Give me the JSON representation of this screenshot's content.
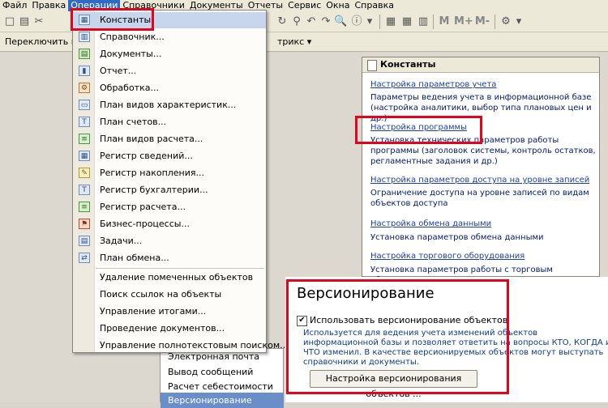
{
  "menubar": {
    "items": [
      "Файл",
      "Правка",
      "Операции",
      "Справочники",
      "Документы",
      "Отчеты",
      "Сервис",
      "Окна",
      "Справка"
    ]
  },
  "toolbar": {
    "m_label": "M",
    "mplus_label": "M+",
    "mminus_label": "M-"
  },
  "bar2": {
    "left_text": "Переключить инте",
    "right_text": "трикс"
  },
  "dropdown": {
    "items": [
      "Константы",
      "Справочник...",
      "Документы...",
      "Отчет...",
      "Обработка...",
      "План видов характеристик...",
      "План счетов...",
      "План видов расчета...",
      "Регистр сведений...",
      "Регистр накопления...",
      "Регистр бухгалтерии...",
      "Регистр расчета...",
      "Бизнес-процессы...",
      "Задачи...",
      "План обмена..."
    ],
    "items2": [
      "Удаление помеченных объектов",
      "Поиск ссылок на объекты",
      "Управление итогами...",
      "Проведение документов...",
      "Управление полнотекстовым поиском..."
    ]
  },
  "constants_panel": {
    "title": "Константы",
    "sections": [
      {
        "link": "Настройка параметров учета",
        "desc": "Параметры ведения учета в информационной базе (настройка аналитики, выбор типа плановых цен и др.)"
      },
      {
        "link": "Настройка программы",
        "desc": "Установка технических параметров работы программы (заголовок системы, контроль остатков, регламентные задания и др.)"
      },
      {
        "link": "Настройка параметров доступа на уровне записей",
        "desc": "Ограничение доступа на уровне записей по видам объектов доступа"
      },
      {
        "link": "Настройка обмена данными",
        "desc": "Установка параметров обмена данными"
      },
      {
        "link": "Настройка торгового оборудования",
        "desc": "Установка параметров работы с торговым оборудованием"
      }
    ]
  },
  "left_list": {
    "items": [
      "Электронная почта",
      "Вывод сообщений",
      "Расчет себестоимости",
      "Версионирование"
    ]
  },
  "versioning": {
    "title": "Версионирование",
    "checkbox_label": "Использовать версионирование объектов",
    "checked_mark": "✔",
    "description": "Используется для ведения учета изменений объектов информационной базы и позволяет ответить на вопросы КТО, КОГДА и ЧТО изменил. В качестве версионируемых объектов могут выступать справочники и документы.",
    "button_label": "Настройка версионирования объектов ..."
  }
}
